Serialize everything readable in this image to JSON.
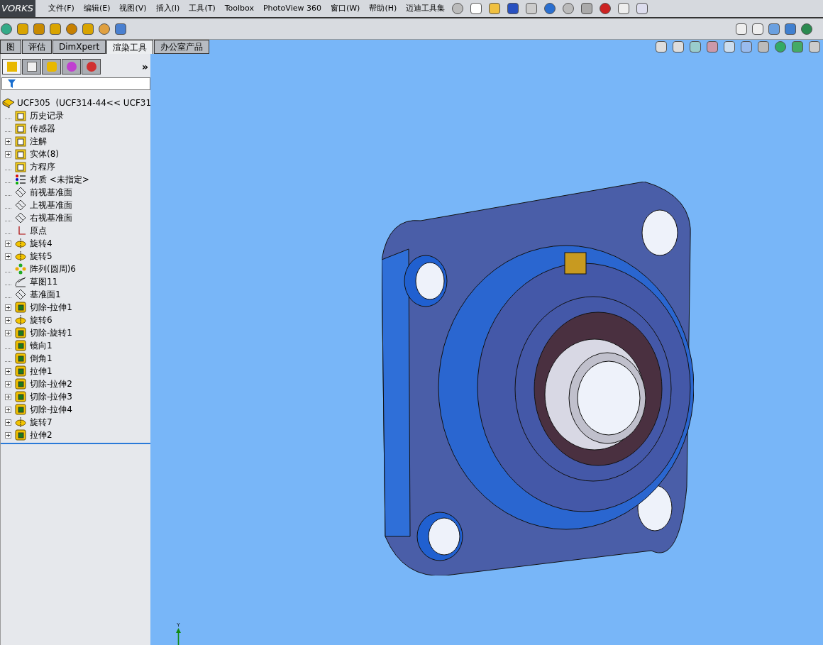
{
  "app_logo": "VORKS",
  "menu": [
    "文件(F)",
    "编辑(E)",
    "视图(V)",
    "插入(I)",
    "工具(T)",
    "Toolbox",
    "PhotoView 360",
    "窗口(W)",
    "帮助(H)",
    "迈迪工具集"
  ],
  "command_tabs": [
    {
      "label": "图",
      "selected": false
    },
    {
      "label": "评估",
      "selected": false
    },
    {
      "label": "DimXpert",
      "selected": false
    },
    {
      "label": "渲染工具",
      "selected": true
    },
    {
      "label": "办公室产品",
      "selected": false
    }
  ],
  "panel_tabs": [
    {
      "kind": "feature",
      "selected": true
    },
    {
      "kind": "property",
      "selected": false
    },
    {
      "kind": "config",
      "selected": false
    },
    {
      "kind": "dimxpert",
      "selected": false
    },
    {
      "kind": "display",
      "selected": false
    }
  ],
  "panel_more": "»",
  "tree": {
    "root": "UCF305  (UCF314-44<< UCF31",
    "items": [
      {
        "label": "历史记录",
        "kind": "folder",
        "expandable": false
      },
      {
        "label": "传感器",
        "kind": "folder",
        "expandable": false
      },
      {
        "label": "注解",
        "kind": "folder",
        "expandable": true
      },
      {
        "label": "实体(8)",
        "kind": "folder",
        "expandable": true
      },
      {
        "label": "方程序",
        "kind": "folder",
        "expandable": false
      },
      {
        "label": "材质 <未指定>",
        "kind": "material",
        "expandable": false
      },
      {
        "label": "前视基准面",
        "kind": "plane",
        "expandable": false
      },
      {
        "label": "上视基准面",
        "kind": "plane",
        "expandable": false
      },
      {
        "label": "右视基准面",
        "kind": "plane",
        "expandable": false
      },
      {
        "label": "原点",
        "kind": "origin",
        "expandable": false
      },
      {
        "label": "旋转4",
        "kind": "revolve",
        "expandable": true
      },
      {
        "label": "旋转5",
        "kind": "revolve",
        "expandable": true
      },
      {
        "label": "阵列(圆周)6",
        "kind": "pattern",
        "expandable": false
      },
      {
        "label": "草图11",
        "kind": "sketch",
        "expandable": false
      },
      {
        "label": "基准面1",
        "kind": "plane",
        "expandable": false
      },
      {
        "label": "切除-拉伸1",
        "kind": "feature",
        "expandable": true
      },
      {
        "label": "旋转6",
        "kind": "revolve",
        "expandable": true
      },
      {
        "label": "切除-旋转1",
        "kind": "feature",
        "expandable": true
      },
      {
        "label": "镜向1",
        "kind": "feature",
        "expandable": false
      },
      {
        "label": "倒角1",
        "kind": "feature",
        "expandable": false
      },
      {
        "label": "拉伸1",
        "kind": "feature",
        "expandable": true
      },
      {
        "label": "切除-拉伸2",
        "kind": "feature",
        "expandable": true
      },
      {
        "label": "切除-拉伸3",
        "kind": "feature",
        "expandable": true
      },
      {
        "label": "切除-拉伸4",
        "kind": "feature",
        "expandable": true
      },
      {
        "label": "旋转7",
        "kind": "revolve",
        "expandable": true
      },
      {
        "label": "拉伸2",
        "kind": "feature",
        "expandable": true
      }
    ]
  },
  "axis_label": "Y"
}
